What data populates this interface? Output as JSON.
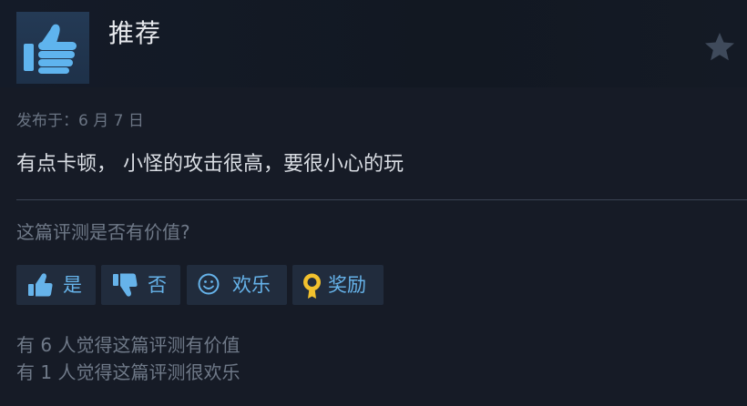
{
  "review": {
    "verdict": "推荐",
    "posted_date": "发布于：6 月 7 日",
    "text": "有点卡顿， 小怪的攻击很高，要很小心的玩"
  },
  "header": {
    "thumb_icon": "thumbs-up-icon",
    "star_icon": "star-icon"
  },
  "feedback": {
    "question": "这篇评测是否有价值?",
    "buttons": [
      {
        "label": "是",
        "icon": "thumbs-up-icon"
      },
      {
        "label": "否",
        "icon": "thumbs-down-icon"
      },
      {
        "label": "欢乐",
        "icon": "smiley-icon"
      },
      {
        "label": "奖励",
        "icon": "award-icon"
      }
    ]
  },
  "stats": {
    "helpful": "有 6 人觉得这篇评测有价值",
    "funny": "有 1 人觉得这篇评测很欢乐"
  },
  "colors": {
    "background": "#161b26",
    "header_background": "#131a25",
    "button_background": "#212c3d",
    "accent": "#66b3ea",
    "award_gold": "#f2c12e",
    "muted_text": "#6f7988"
  }
}
